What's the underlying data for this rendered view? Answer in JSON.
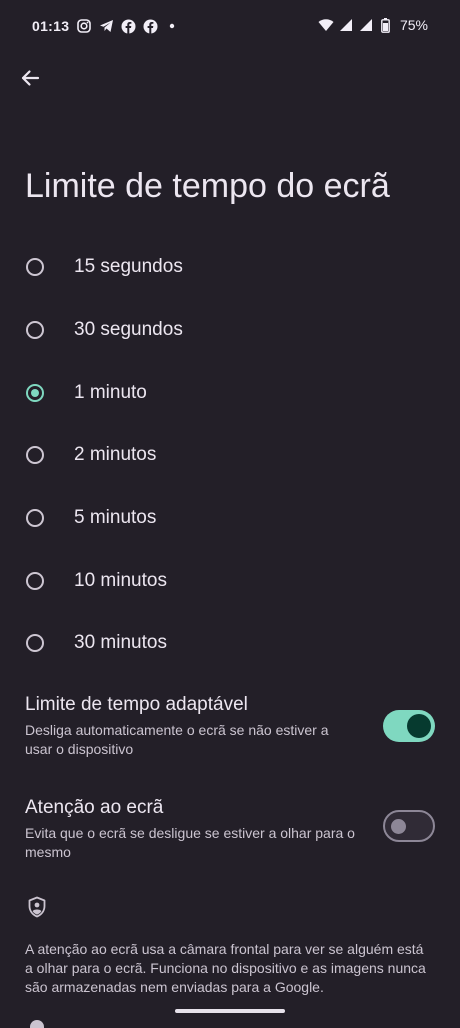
{
  "status_bar": {
    "time": "01:13",
    "left_icons": [
      "instagram-icon",
      "telegram-icon",
      "facebook-icon",
      "facebook-icon",
      "notification-dot-icon"
    ],
    "right_icons": [
      "wifi-icon",
      "signal-icon",
      "signal-icon",
      "battery-icon"
    ],
    "battery": "75%"
  },
  "header": {
    "back_icon": "arrow-back-icon",
    "title": "Limite de tempo do ecrã"
  },
  "timeout_options": [
    {
      "label": "15 segundos",
      "selected": false
    },
    {
      "label": "30 segundos",
      "selected": false
    },
    {
      "label": "1 minuto",
      "selected": true
    },
    {
      "label": "2 minutos",
      "selected": false
    },
    {
      "label": "5 minutos",
      "selected": false
    },
    {
      "label": "10 minutos",
      "selected": false
    },
    {
      "label": "30 minutos",
      "selected": false
    }
  ],
  "adaptive": {
    "title": "Limite de tempo adaptável",
    "description": "Desliga automaticamente o ecrã se não estiver a usar o dispositivo",
    "enabled": true
  },
  "attention": {
    "title": "Atenção ao ecrã",
    "description": "Evita que o ecrã se desligue se estiver a olhar para o mesmo",
    "enabled": false
  },
  "privacy": {
    "icon": "shield-person-icon",
    "text": "A atenção ao ecrã usa a câmara frontal para ver se alguém está a olhar para o ecrã. Funciona no dispositivo e as imagens nunca são armazenadas nem enviadas para a Google."
  },
  "colors": {
    "background": "#231f28",
    "accent": "#7fd8c0",
    "text": "#ece6f0"
  }
}
